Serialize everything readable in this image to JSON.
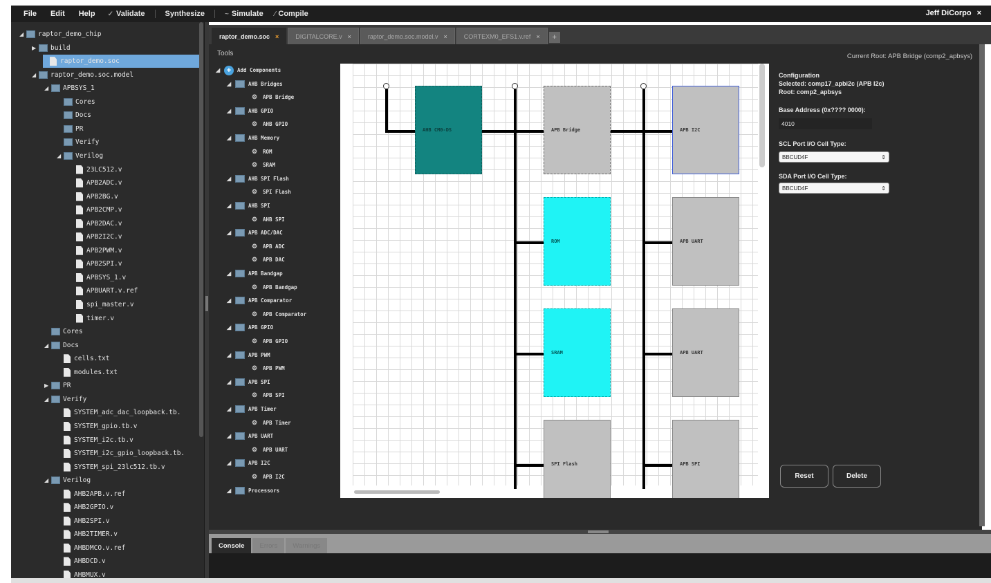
{
  "menu": {
    "file": "File",
    "edit": "Edit",
    "help": "Help",
    "validate": "Validate",
    "synthesize": "Synthesize",
    "simulate": "Simulate",
    "compile": "Compile",
    "user": "Jeff DiCorpo",
    "user_close": "×"
  },
  "tree": [
    {
      "label": "raptor_demo_chip",
      "kind": "folder",
      "level": 0,
      "arrow": "◢"
    },
    {
      "label": "build",
      "kind": "folder",
      "level": 1,
      "arrow": "▶"
    },
    {
      "label": "raptor_demo.soc",
      "kind": "file",
      "level": 1,
      "arrow": "",
      "selected": true
    },
    {
      "label": "raptor_demo.soc.model",
      "kind": "folder",
      "level": 1,
      "arrow": "◢"
    },
    {
      "label": "APBSYS_1",
      "kind": "folder",
      "level": 2,
      "arrow": "◢"
    },
    {
      "label": "Cores",
      "kind": "folder",
      "level": 3,
      "arrow": ""
    },
    {
      "label": "Docs",
      "kind": "folder",
      "level": 3,
      "arrow": ""
    },
    {
      "label": "PR",
      "kind": "folder",
      "level": 3,
      "arrow": ""
    },
    {
      "label": "Verify",
      "kind": "folder",
      "level": 3,
      "arrow": ""
    },
    {
      "label": "Verilog",
      "kind": "folder",
      "level": 3,
      "arrow": "◢"
    },
    {
      "label": "23LC512.v",
      "kind": "file",
      "level": 4,
      "arrow": ""
    },
    {
      "label": "APB2ADC.v",
      "kind": "file",
      "level": 4,
      "arrow": ""
    },
    {
      "label": "APB2BG.v",
      "kind": "file",
      "level": 4,
      "arrow": ""
    },
    {
      "label": "APB2CMP.v",
      "kind": "file",
      "level": 4,
      "arrow": ""
    },
    {
      "label": "APB2DAC.v",
      "kind": "file",
      "level": 4,
      "arrow": ""
    },
    {
      "label": "APB2I2C.v",
      "kind": "file",
      "level": 4,
      "arrow": ""
    },
    {
      "label": "APB2PWM.v",
      "kind": "file",
      "level": 4,
      "arrow": ""
    },
    {
      "label": "APB2SPI.v",
      "kind": "file",
      "level": 4,
      "arrow": ""
    },
    {
      "label": "APBSYS_1.v",
      "kind": "file",
      "level": 4,
      "arrow": ""
    },
    {
      "label": "APBUART.v.ref",
      "kind": "file",
      "level": 4,
      "arrow": ""
    },
    {
      "label": "spi_master.v",
      "kind": "file",
      "level": 4,
      "arrow": ""
    },
    {
      "label": "timer.v",
      "kind": "file",
      "level": 4,
      "arrow": ""
    },
    {
      "label": "Cores",
      "kind": "folder",
      "level": 2,
      "arrow": ""
    },
    {
      "label": "Docs",
      "kind": "folder",
      "level": 2,
      "arrow": "◢"
    },
    {
      "label": "cells.txt",
      "kind": "file",
      "level": 3,
      "arrow": ""
    },
    {
      "label": "modules.txt",
      "kind": "file",
      "level": 3,
      "arrow": ""
    },
    {
      "label": "PR",
      "kind": "folder",
      "level": 2,
      "arrow": "▶"
    },
    {
      "label": "Verify",
      "kind": "folder",
      "level": 2,
      "arrow": "◢"
    },
    {
      "label": "SYSTEM_adc_dac_loopback.tb.",
      "kind": "file",
      "level": 3,
      "arrow": ""
    },
    {
      "label": "SYSTEM_gpio.tb.v",
      "kind": "file",
      "level": 3,
      "arrow": ""
    },
    {
      "label": "SYSTEM_i2c.tb.v",
      "kind": "file",
      "level": 3,
      "arrow": ""
    },
    {
      "label": "SYSTEM_i2c_gpio_loopback.tb.",
      "kind": "file",
      "level": 3,
      "arrow": ""
    },
    {
      "label": "SYSTEM_spi_23lc512.tb.v",
      "kind": "file",
      "level": 3,
      "arrow": ""
    },
    {
      "label": "Verilog",
      "kind": "folder",
      "level": 2,
      "arrow": "◢"
    },
    {
      "label": "AHB2APB.v.ref",
      "kind": "file",
      "level": 3,
      "arrow": ""
    },
    {
      "label": "AHB2GPIO.v",
      "kind": "file",
      "level": 3,
      "arrow": ""
    },
    {
      "label": "AHB2SPI.v",
      "kind": "file",
      "level": 3,
      "arrow": ""
    },
    {
      "label": "AHB2TIMER.v",
      "kind": "file",
      "level": 3,
      "arrow": ""
    },
    {
      "label": "AHBDMCO.v.ref",
      "kind": "file",
      "level": 3,
      "arrow": ""
    },
    {
      "label": "AHBDCD.v",
      "kind": "file",
      "level": 3,
      "arrow": ""
    },
    {
      "label": "AHBMUX.v",
      "kind": "file",
      "level": 3,
      "arrow": ""
    }
  ],
  "tabs": [
    {
      "label": "raptor_demo.soc",
      "active": true
    },
    {
      "label": "DIGITALCORE.v",
      "active": false
    },
    {
      "label": "raptor_demo.soc.model.v",
      "active": false
    },
    {
      "label": "CORTEXM0_EFS1.v.ref",
      "active": false
    }
  ],
  "tab_close": "×",
  "tab_add": "+",
  "tools": {
    "title": "Tools",
    "current_root": "Current Root: APB Bridge (comp2_apbsys)",
    "items": [
      {
        "label": "Add Components",
        "kind": "root"
      },
      {
        "label": "AHB Bridges",
        "kind": "cat"
      },
      {
        "label": "APB Bridge",
        "kind": "item"
      },
      {
        "label": "AHB GPIO",
        "kind": "cat"
      },
      {
        "label": "AHB GPIO",
        "kind": "item"
      },
      {
        "label": "AHB Memory",
        "kind": "cat"
      },
      {
        "label": "ROM",
        "kind": "item"
      },
      {
        "label": "SRAM",
        "kind": "item"
      },
      {
        "label": "AHB SPI Flash",
        "kind": "cat"
      },
      {
        "label": "SPI Flash",
        "kind": "item"
      },
      {
        "label": "AHB SPI",
        "kind": "cat"
      },
      {
        "label": "AHB SPI",
        "kind": "item"
      },
      {
        "label": "APB ADC/DAC",
        "kind": "cat"
      },
      {
        "label": "APB ADC",
        "kind": "item"
      },
      {
        "label": "APB DAC",
        "kind": "item"
      },
      {
        "label": "APB Bandgap",
        "kind": "cat"
      },
      {
        "label": "APB Bandgap",
        "kind": "item"
      },
      {
        "label": "APB Comparator",
        "kind": "cat"
      },
      {
        "label": "APB Comparator",
        "kind": "item"
      },
      {
        "label": "APB GPIO",
        "kind": "cat"
      },
      {
        "label": "APB GPIO",
        "kind": "item"
      },
      {
        "label": "APB PWM",
        "kind": "cat"
      },
      {
        "label": "APB PWM",
        "kind": "item"
      },
      {
        "label": "APB SPI",
        "kind": "cat"
      },
      {
        "label": "APB SPI",
        "kind": "item"
      },
      {
        "label": "APB Timer",
        "kind": "cat"
      },
      {
        "label": "APB Timer",
        "kind": "item"
      },
      {
        "label": "APB UART",
        "kind": "cat"
      },
      {
        "label": "APB UART",
        "kind": "item"
      },
      {
        "label": "APB I2C",
        "kind": "cat"
      },
      {
        "label": "APB I2C",
        "kind": "item"
      },
      {
        "label": "Processors",
        "kind": "cat"
      }
    ]
  },
  "canvas": {
    "blocks": {
      "ahb_cm0": "AHB CM0-DS",
      "apb_bridge": "APB Bridge",
      "apb_i2c": "APB I2C",
      "rom": "ROM",
      "sram": "SRAM",
      "spi_flash": "SPI Flash",
      "apb_uart1": "APB UART",
      "apb_uart2": "APB UART",
      "apb_spi": "APB SPI"
    }
  },
  "config": {
    "heading": "Configuration",
    "selected": "Selected: comp17_apbi2c (APB I2c)",
    "root": "Root: comp2_apbsys",
    "base_label": "Base Address (0x???? 0000):",
    "base_value": "4010",
    "scl_label": "SCL Port I/O Cell Type:",
    "scl_value": "BBCUD4F",
    "sda_label": "SDA Port I/O Cell Type:",
    "sda_value": "BBCUD4F",
    "select_arrow": "⇕",
    "reset": "Reset",
    "delete": "Delete"
  },
  "console": {
    "tabs": [
      "Console",
      "Errors",
      "Warnings"
    ]
  },
  "colors": {
    "teal": "#138480",
    "cyan": "#1ff3f5",
    "gray_block": "#c0c0c0",
    "selected_tree": "#6fa8dc"
  }
}
